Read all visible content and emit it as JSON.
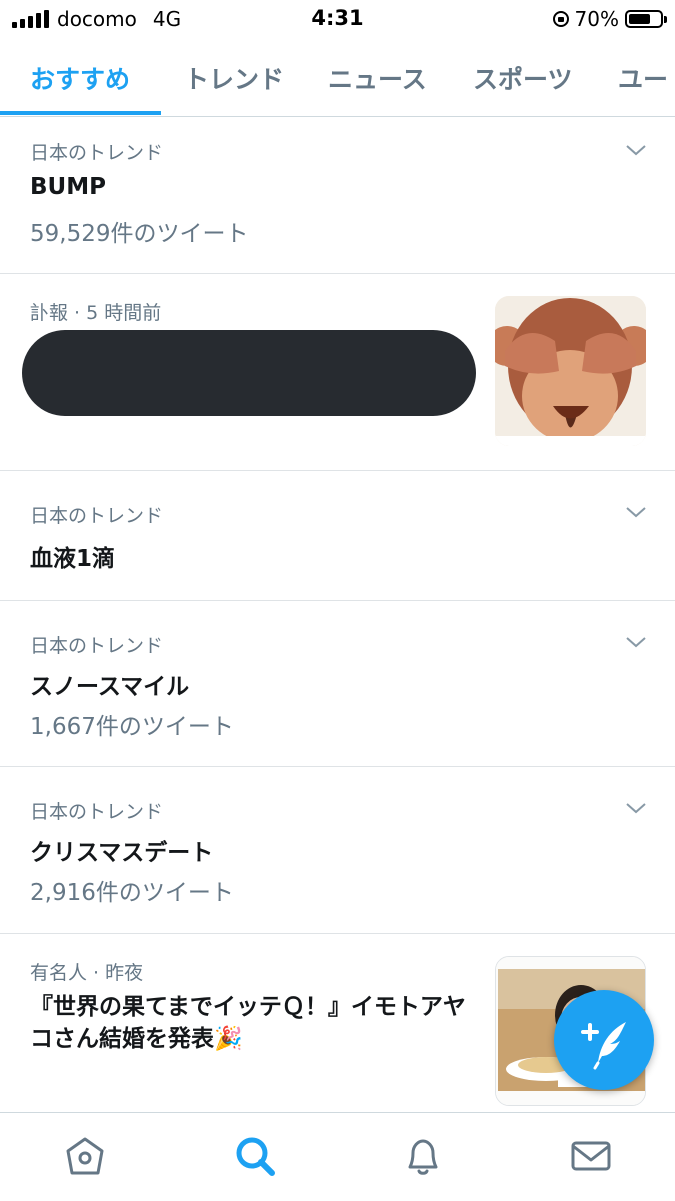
{
  "status_bar": {
    "carrier": "docomo",
    "network": "4G",
    "time": "4:31",
    "battery": "70%",
    "battery_level": 0.7
  },
  "tabs": [
    {
      "label": "おすすめ",
      "active": true
    },
    {
      "label": "トレンド"
    },
    {
      "label": "ニュース"
    },
    {
      "label": "スポーツ"
    },
    {
      "label": "ユー"
    }
  ],
  "feed": [
    {
      "type": "trend",
      "meta": "日本のトレンド",
      "title": "BUMP",
      "count": "59,529件のツイート"
    },
    {
      "type": "news",
      "meta": "訃報 · 5 時間前",
      "headline_redacted": true,
      "thumbnail": "monkey-emoji"
    },
    {
      "type": "trend",
      "meta": "日本のトレンド",
      "title": "血液1滴"
    },
    {
      "type": "trend",
      "meta": "日本のトレンド",
      "title": "スノースマイル",
      "count": "1,667件のツイート"
    },
    {
      "type": "trend",
      "meta": "日本のトレンド",
      "title": "クリスマスデート",
      "count": "2,916件のツイート"
    },
    {
      "type": "news",
      "meta": "有名人 · 昨夜",
      "headline": "『世界の果てまでイッテＱ！』イモトアヤコさん結婚を発表🎉",
      "thumbnail": "person-photo"
    }
  ],
  "fab": {
    "icon": "compose-tweet-icon"
  },
  "bottom_nav": [
    {
      "icon": "home-icon"
    },
    {
      "icon": "search-icon",
      "active": true
    },
    {
      "icon": "bell-icon"
    },
    {
      "icon": "mail-icon"
    }
  ],
  "colors": {
    "accent": "#1da1f2",
    "secondary_text": "#657786",
    "primary_text": "#14171a"
  }
}
